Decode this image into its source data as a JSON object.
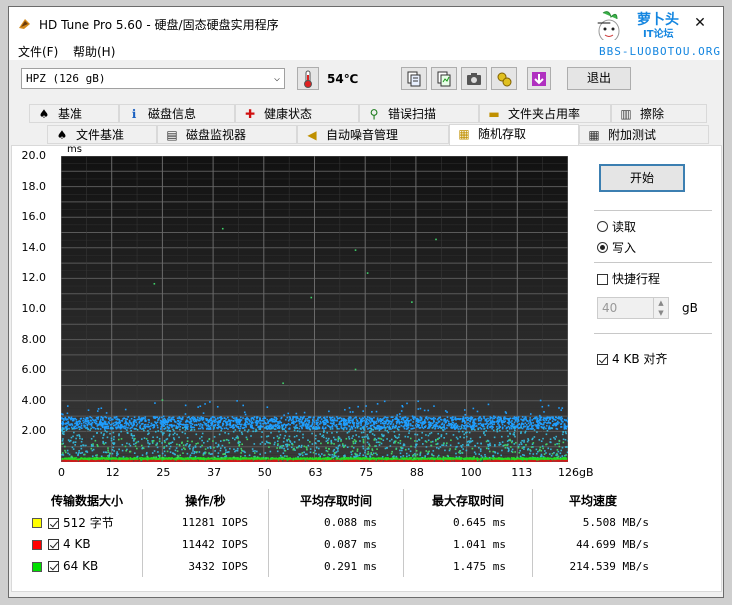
{
  "window": {
    "title": "HD Tune Pro 5.60 - 硬盘/固态硬盘实用程序",
    "minimize": "—",
    "close": "✕"
  },
  "watermark": {
    "line1": "萝卜头",
    "line2": "IT论坛",
    "url": "BBS-LUOBOTOU.ORG"
  },
  "menu": {
    "file": "文件(F)",
    "help": "帮助(H)"
  },
  "toolbar": {
    "drive": "HPZ (126 gB)",
    "temperature": "54℃",
    "exit_label": "退出",
    "icons": [
      "copy-info-icon",
      "copy-results-icon",
      "screenshot-icon",
      "options-icon",
      "save-icon"
    ]
  },
  "tabs_row1": [
    {
      "label": "基准",
      "icon": "benchmark-icon",
      "glyph": "♠"
    },
    {
      "label": "磁盘信息",
      "icon": "info-icon",
      "glyph": "ℹ"
    },
    {
      "label": "健康状态",
      "icon": "health-icon",
      "glyph": "✚"
    },
    {
      "label": "错误扫描",
      "icon": "magnifier-icon",
      "glyph": "🔍"
    },
    {
      "label": "文件夹占用率",
      "icon": "folder-icon",
      "glyph": "▭"
    },
    {
      "label": "擦除",
      "icon": "trash-icon",
      "glyph": "🗑"
    }
  ],
  "tabs_row2": [
    {
      "label": "文件基准",
      "icon": "file-benchmark-icon",
      "glyph": "♠"
    },
    {
      "label": "磁盘监视器",
      "icon": "monitor-icon",
      "glyph": "▤"
    },
    {
      "label": "自动噪音管理",
      "icon": "speaker-icon",
      "glyph": "◀"
    },
    {
      "label": "随机存取",
      "icon": "random-access-icon",
      "glyph": "▦",
      "active": true
    },
    {
      "label": "附加测试",
      "icon": "extra-tests-icon",
      "glyph": "▦"
    }
  ],
  "chart_data": {
    "type": "scatter",
    "ylabel": "ms",
    "ylim": [
      0,
      20
    ],
    "xlim": [
      0,
      126
    ],
    "yticks": [
      "20.0",
      "18.0",
      "16.0",
      "14.0",
      "12.0",
      "10.0",
      "8.00",
      "6.00",
      "4.00",
      "2.00"
    ],
    "xticks": [
      "0",
      "12",
      "25",
      "37",
      "50",
      "63",
      "75",
      "88",
      "100",
      "113",
      "126gB"
    ],
    "grid": true,
    "series": [
      {
        "name": "512 字节",
        "color": "#1f9fff",
        "typical_ms": 2.6
      },
      {
        "name": "4 KB",
        "color": "#d11a1a",
        "typical_ms": 0.1
      },
      {
        "name": "64 KB",
        "color": "#22dd22",
        "typical_ms": 0.25
      }
    ]
  },
  "controls": {
    "start": "开始",
    "read": "读取",
    "write": "写入",
    "mode": "write",
    "short_stroke": "快捷行程",
    "short_stroke_checked": false,
    "stroke_value": "40",
    "stroke_unit": "gB",
    "align_4kb": "4 KB 对齐",
    "align_checked": true
  },
  "results": {
    "headers": [
      "传输数据大小",
      "操作/秒",
      "平均存取时间",
      "最大存取时间",
      "平均速度"
    ],
    "rows": [
      {
        "color": "#ffff00",
        "size": "512 字节",
        "iops": "11281 IOPS",
        "avg": "0.088 ms",
        "max": "0.645 ms",
        "speed": "5.508 MB/s"
      },
      {
        "color": "#ff0000",
        "size": "4 KB",
        "iops": "11442 IOPS",
        "avg": "0.087 ms",
        "max": "1.041 ms",
        "speed": "44.699 MB/s"
      },
      {
        "color": "#00e000",
        "size": "64 KB",
        "iops": "3432 IOPS",
        "avg": "0.291 ms",
        "max": "1.475 ms",
        "speed": "214.539 MB/s"
      }
    ]
  }
}
